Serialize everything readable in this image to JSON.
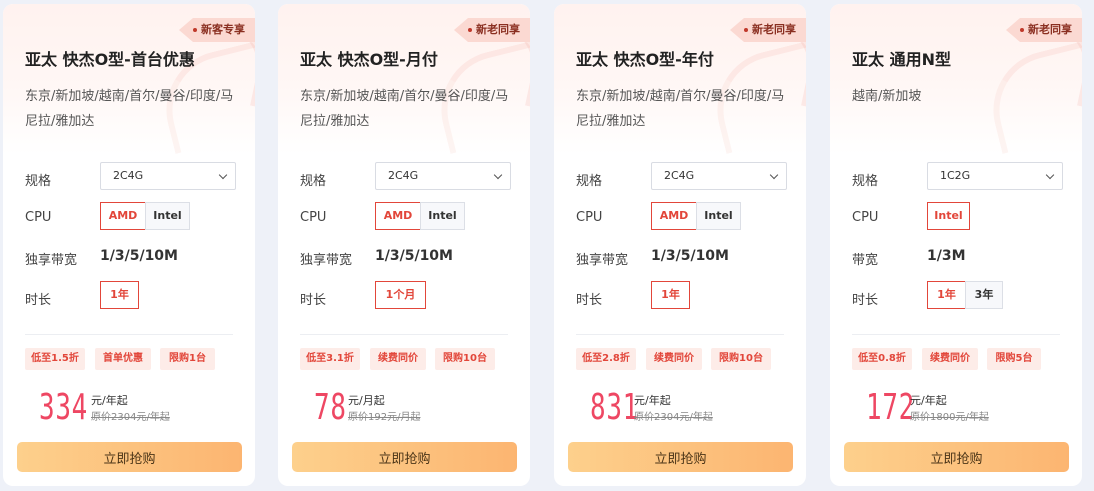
{
  "labels": {
    "spec": "规格",
    "cpu": "CPU",
    "bandwidth_dedicated": "独享带宽",
    "bandwidth": "带宽",
    "duration": "时长",
    "buy": "立即抢购"
  },
  "cards": [
    {
      "tag": "新客专享",
      "title": "亚太 快杰O型-首台优惠",
      "regions": "东京/新加坡/越南/首尔/曼谷/印度/马尼拉/雅加达",
      "spec_value": "2C4G",
      "cpu_options": [
        "AMD",
        "Intel"
      ],
      "cpu_selected": "AMD",
      "bandwidth_label": "独享带宽",
      "bandwidth_value": "1/3/5/10M",
      "duration_options": [
        "1年"
      ],
      "duration_selected": "1年",
      "chips": [
        "低至1.5折",
        "首单优惠",
        "限购1台"
      ],
      "price": "334",
      "price_unit": "元/年起",
      "original_price": "原价2304元/年起"
    },
    {
      "tag": "新老同享",
      "title": "亚太 快杰O型-月付",
      "regions": "东京/新加坡/越南/首尔/曼谷/印度/马尼拉/雅加达",
      "spec_value": "2C4G",
      "cpu_options": [
        "AMD",
        "Intel"
      ],
      "cpu_selected": "AMD",
      "bandwidth_label": "独享带宽",
      "bandwidth_value": "1/3/5/10M",
      "duration_options": [
        "1个月"
      ],
      "duration_selected": "1个月",
      "chips": [
        "低至3.1折",
        "续费同价",
        "限购10台"
      ],
      "price": "78",
      "price_unit": "元/月起",
      "original_price": "原价192元/月起"
    },
    {
      "tag": "新老同享",
      "title": "亚太 快杰O型-年付",
      "regions": "东京/新加坡/越南/首尔/曼谷/印度/马尼拉/雅加达",
      "spec_value": "2C4G",
      "cpu_options": [
        "AMD",
        "Intel"
      ],
      "cpu_selected": "AMD",
      "bandwidth_label": "独享带宽",
      "bandwidth_value": "1/3/5/10M",
      "duration_options": [
        "1年"
      ],
      "duration_selected": "1年",
      "chips": [
        "低至2.8折",
        "续费同价",
        "限购10台"
      ],
      "price": "831",
      "price_unit": "元/年起",
      "original_price": "原价2304元/年起"
    },
    {
      "tag": "新老同享",
      "title": "亚太 通用N型",
      "regions": "越南/新加坡",
      "spec_value": "1C2G",
      "cpu_options": [
        "Intel"
      ],
      "cpu_selected": "Intel",
      "bandwidth_label": "带宽",
      "bandwidth_value": "1/3M",
      "duration_options": [
        "1年",
        "3年"
      ],
      "duration_selected": "1年",
      "chips": [
        "低至0.8折",
        "续费同价",
        "限购5台"
      ],
      "price": "172",
      "price_unit": "元/年起",
      "original_price": "原价1800元/年起"
    }
  ],
  "colors": {
    "accent_red": "#e2463a",
    "price_pink": "#ee4763",
    "button_gradient_start": "#fdd08c",
    "button_gradient_end": "#fcb571",
    "chip_bg": "#fdece8",
    "tag_bg": "#fbd9d2"
  }
}
